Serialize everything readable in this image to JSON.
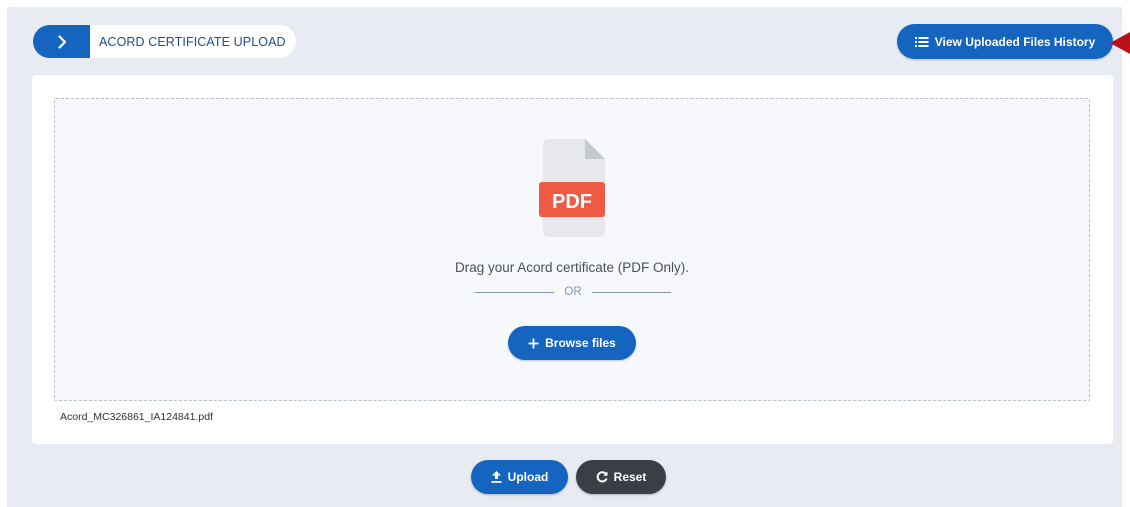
{
  "header": {
    "title": "ACORD CERTIFICATE UPLOAD",
    "toggle_icon": "chevron-right-icon"
  },
  "history_button": {
    "label": "View Uploaded Files History",
    "icon": "list-icon"
  },
  "dropzone": {
    "file_icon": "pdf-file-icon",
    "file_icon_label": "PDF",
    "instruction": "Drag your Acord certificate (PDF Only).",
    "or_text": "OR",
    "browse_label": "Browse files",
    "browse_icon": "plus-icon"
  },
  "selected_file": "Acord_MC326861_IA124841.pdf",
  "actions": {
    "upload_label": "Upload",
    "upload_icon": "upload-icon",
    "reset_label": "Reset",
    "reset_icon": "reset-icon"
  },
  "colors": {
    "primary": "#1565c0",
    "dark": "#3a3f47",
    "background": "#e8ecf2",
    "pdf_badge": "#ef5a45",
    "marker": "#b80f1a"
  }
}
